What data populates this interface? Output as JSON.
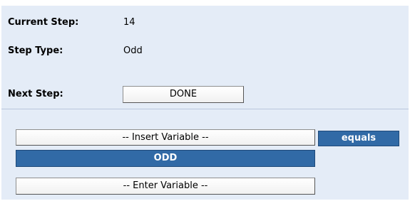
{
  "step_info": {
    "current_step_label": "Current Step:",
    "current_step_value": "14",
    "step_type_label": "Step Type:",
    "step_type_value": "Odd",
    "next_step_label": "Next Step:",
    "next_step_button": "DONE"
  },
  "condition": {
    "insert_variable_button": "-- Insert Variable --",
    "operator_button": "equals",
    "value_bar": "ODD",
    "enter_variable_button": "-- Enter Variable --"
  },
  "colors": {
    "panel_background": "#e4ecf7",
    "accent_dark_blue": "#316aa6"
  }
}
